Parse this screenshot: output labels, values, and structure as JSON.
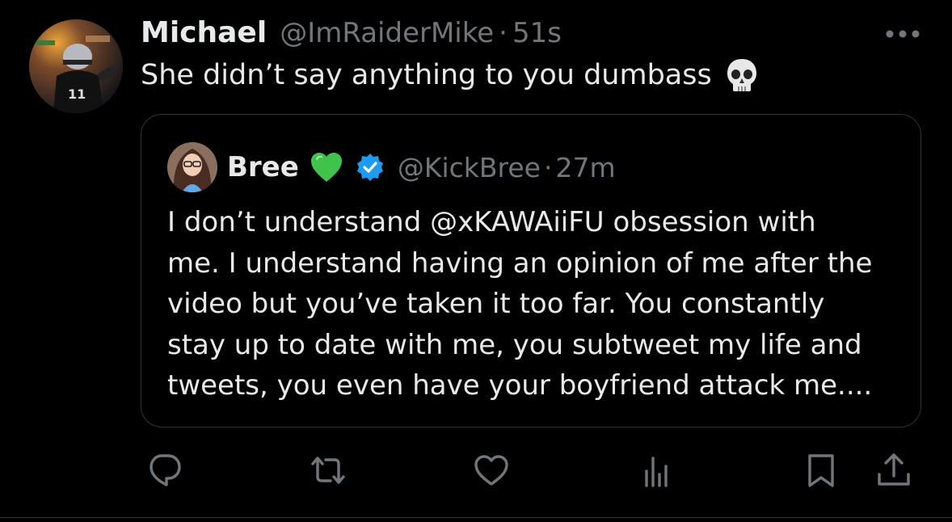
{
  "tweet": {
    "author_name": "Michael",
    "author_handle": "@ImRaiderMike",
    "separator": "·",
    "time": "51s",
    "text": "She didn’t say anything to you dumbass",
    "emoji": "skull-icon"
  },
  "quoted_tweet": {
    "author_name": "Bree",
    "name_emoji": "green-heart-icon",
    "verified": true,
    "author_handle": "@KickBree",
    "separator": "·",
    "time": "27m",
    "text_lines": [
      "I don’t understand @xKAWAiiFU obsession with",
      "me. I understand having an opinion of me after the",
      "video but you’ve taken it too far. You constantly",
      "stay up to date with me, you subtweet my life and",
      "tweets, you even have your boyfriend attack me...."
    ]
  },
  "actions": [
    "reply-icon",
    "retweet-icon",
    "like-icon",
    "views-icon",
    "bookmark-icon",
    "share-icon"
  ],
  "colors": {
    "background": "#000000",
    "text": "#e7e9ea",
    "secondary_text": "#71767b",
    "border": "#2f3336",
    "verified_blue": "#1d9bf0",
    "green_heart": "#3fc34a"
  }
}
